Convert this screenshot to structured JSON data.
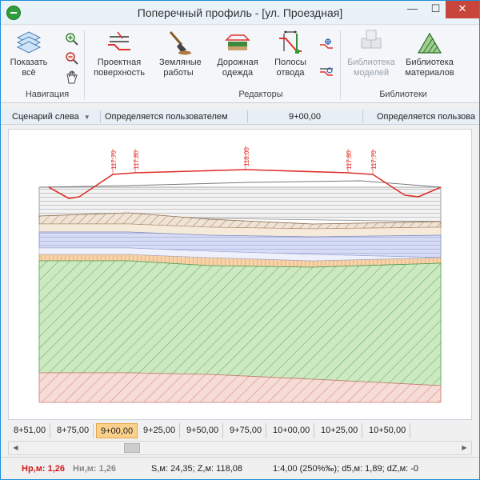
{
  "window": {
    "title": "Поперечный профиль - [ул. Проездная]",
    "controls": {
      "minimize": "—",
      "maximize": "☐",
      "close": "✕"
    }
  },
  "ribbon": {
    "buttons": {
      "show_all": "Показать всё",
      "design_surface": "Проектная поверхность",
      "earthworks": "Земляные работы",
      "road_pavement": "Дорожная одежда",
      "right_of_way": "Полосы отвода",
      "model_library": "Библиотека моделей",
      "material_library": "Библиотека материалов"
    },
    "groups": {
      "navigation": "Навигация",
      "editors": "Редакторы",
      "libraries": "Библиотеки"
    },
    "icons": {
      "show_all": "layers-icon",
      "zoom_in": "zoom-in-icon",
      "zoom_out": "zoom-out-icon",
      "pan": "hand-icon",
      "design_surface": "surface-icon",
      "earthworks": "shovel-icon",
      "road_pavement": "pavement-icon",
      "right_of_way": "boundary-icon",
      "edit_point": "point-edit-icon",
      "edit_line": "line-edit-icon",
      "model_library": "cubes-icon",
      "material_library": "hatch-icon"
    }
  },
  "infobar": {
    "scenario": "Сценарий слева",
    "user_defined_1": "Определяется пользователем",
    "station": "9+00,00",
    "user_defined_2": "Определяется пользова"
  },
  "profile": {
    "labels": [
      "117,70",
      "117,80",
      "118,00",
      "117,80",
      "117,70"
    ],
    "colors": {
      "design_line": "#e0302a",
      "soil_green": "#cde9c2",
      "soil_red": "#f6dcd6",
      "soil_blue": "#d6dcf3",
      "soil_orange": "#f7d3a7",
      "soil_brown": "#e9ddd0"
    }
  },
  "pickets": {
    "items": [
      "8+51,00",
      "8+75,00",
      "9+00,00",
      "9+25,00",
      "9+50,00",
      "9+75,00",
      "10+00,00",
      "10+25,00",
      "10+50,00"
    ],
    "active_index": 2
  },
  "status": {
    "hr": "Нр,м: 1,26",
    "hi": "Ни,м: 1,26",
    "sz": "S,м: 24,35;  Z,м: 118,08",
    "scale": "1:4,00 (250%‰);  d5,м: 1,89;  dZ,м: -0"
  }
}
